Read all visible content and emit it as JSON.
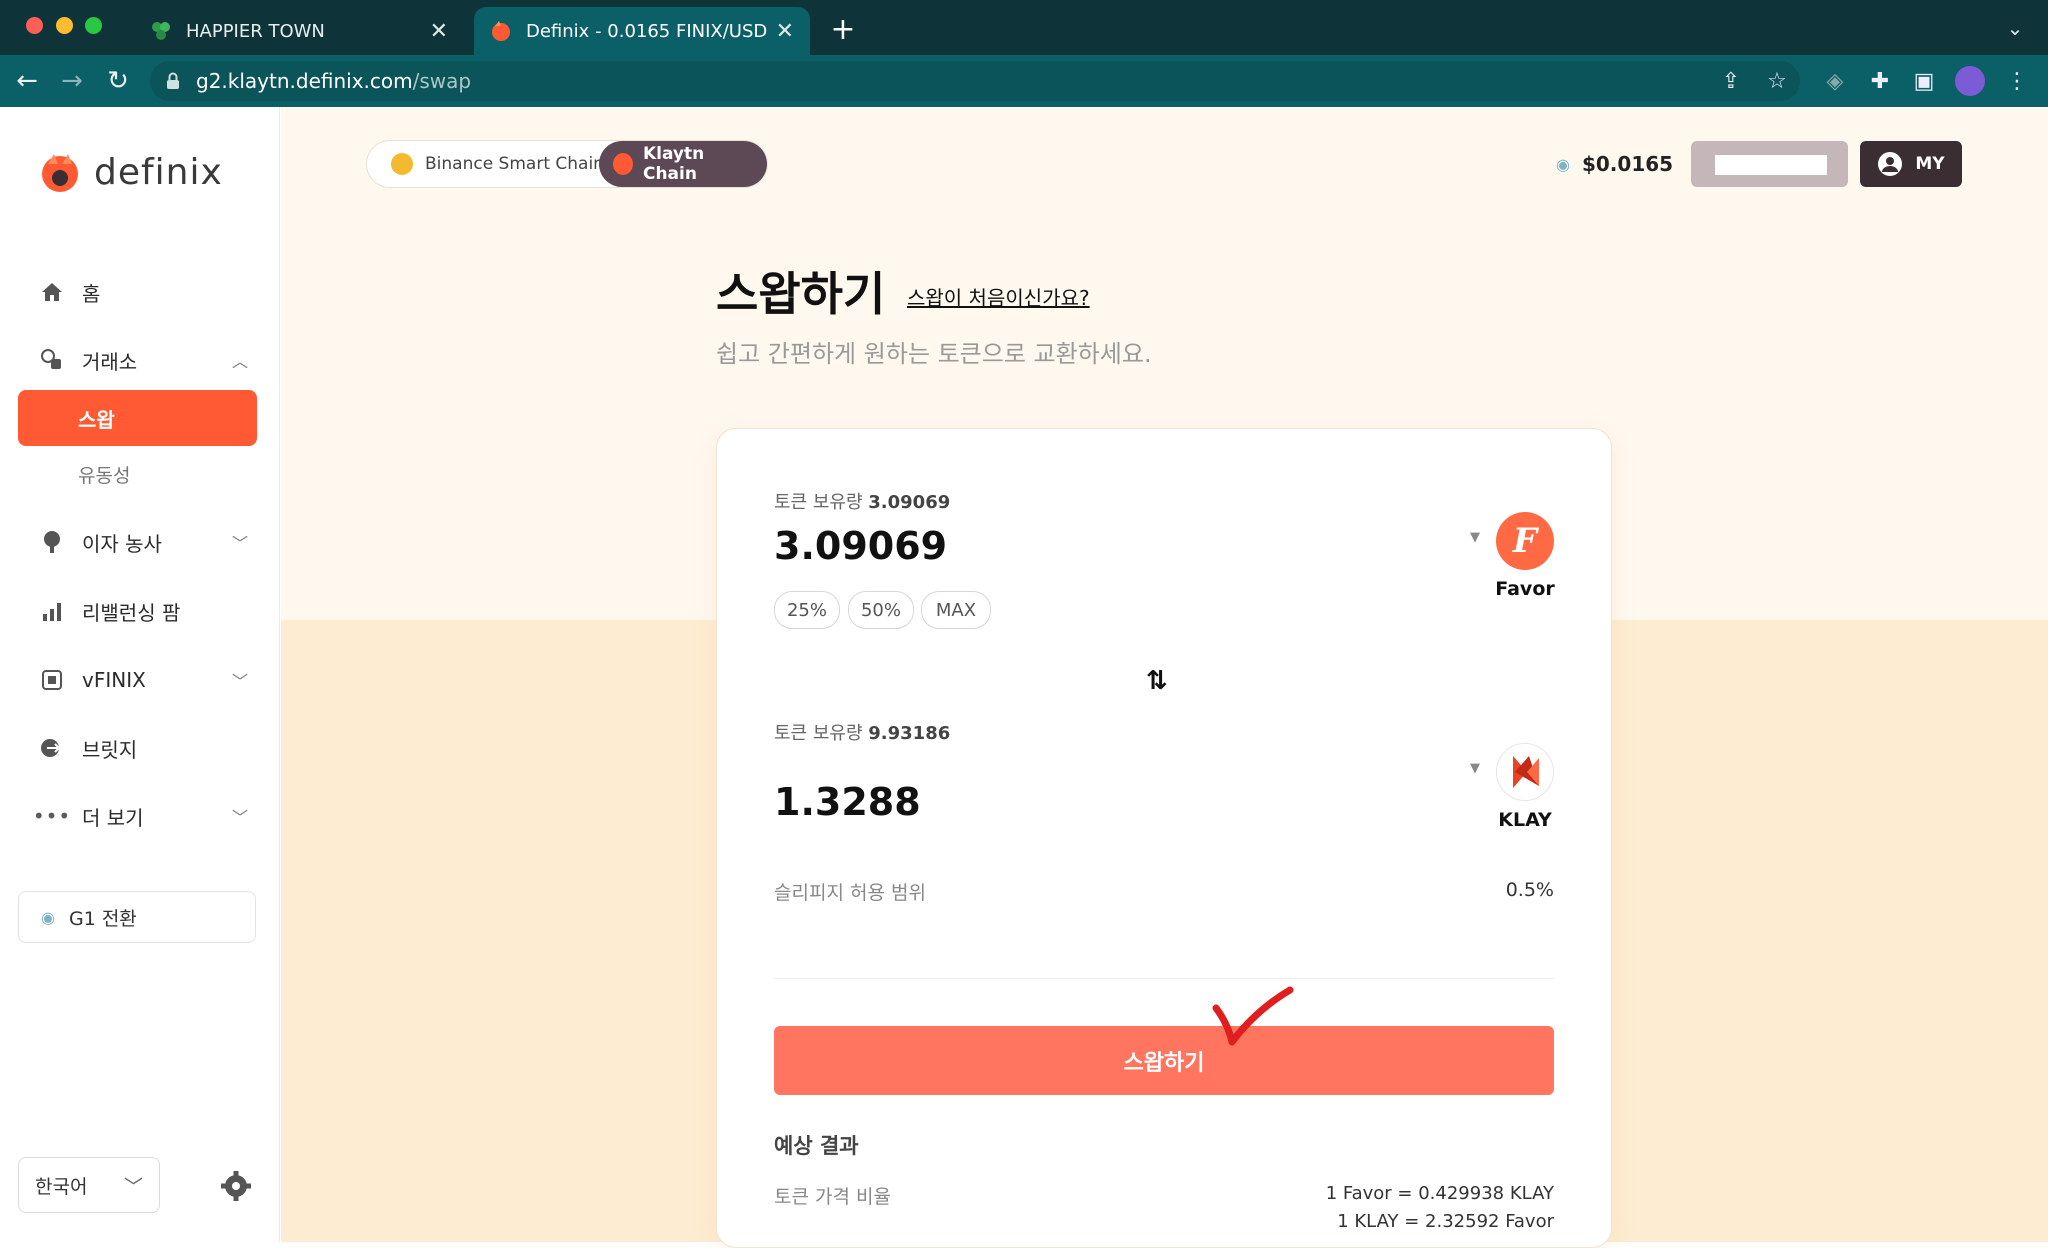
{
  "browser": {
    "tabs": [
      {
        "title": "HAPPIER TOWN",
        "active": false
      },
      {
        "title": "Definix - 0.0165 FINIX/USD",
        "active": true
      }
    ],
    "url": {
      "host": "g2.klaytn.definix.com",
      "path": "/swap"
    }
  },
  "sidebar": {
    "logo_text": "definix",
    "items": [
      {
        "label": "홈",
        "icon": "home-icon"
      },
      {
        "label": "거래소",
        "icon": "exchange-icon",
        "expanded": true
      },
      {
        "label": "스왑",
        "icon": "",
        "selected": true
      },
      {
        "label": "유동성",
        "icon": ""
      },
      {
        "label": "이자 농사",
        "icon": "farm-icon"
      },
      {
        "label": "리밸런싱 팜",
        "icon": "bar-chart-icon"
      },
      {
        "label": "vFINIX",
        "icon": "vfinix-icon"
      },
      {
        "label": "브릿지",
        "icon": "bridge-icon"
      },
      {
        "label": "더 보기",
        "icon": "more-icon"
      }
    ],
    "g1_label": "G1 전환",
    "language": "한국어"
  },
  "header": {
    "chains": [
      "Binance Smart Chain",
      "Klaytn Chain"
    ],
    "active_chain": "Klaytn Chain",
    "price": "$0.0165",
    "my_label": "MY"
  },
  "swap": {
    "title": "스왑하기",
    "help_link": "스왑이 처음이신가요?",
    "subtitle": "쉽고 간편하게 원하는 토큰으로 교환하세요.",
    "from": {
      "balance_label": "토큰 보유량",
      "balance": "3.09069",
      "amount": "3.09069",
      "token": "Favor"
    },
    "percent_buttons": [
      "25%",
      "50%",
      "MAX"
    ],
    "to": {
      "balance_label": "토큰 보유량",
      "balance": "9.93186",
      "amount": "1.3288",
      "token": "KLAY"
    },
    "slippage_label": "슬리피지 허용 범위",
    "slippage_value": "0.5%",
    "submit_label": "스왑하기",
    "result_title": "예상 결과",
    "rate_label": "토큰 가격 비율",
    "rates": [
      "1 Favor = 0.429938 KLAY",
      "1 KLAY = 2.32592 Favor"
    ]
  },
  "colors": {
    "accent": "#ff5a34",
    "submit": "#ff7560",
    "chain_active": "#5d4856",
    "my_button": "#3a2e33"
  }
}
